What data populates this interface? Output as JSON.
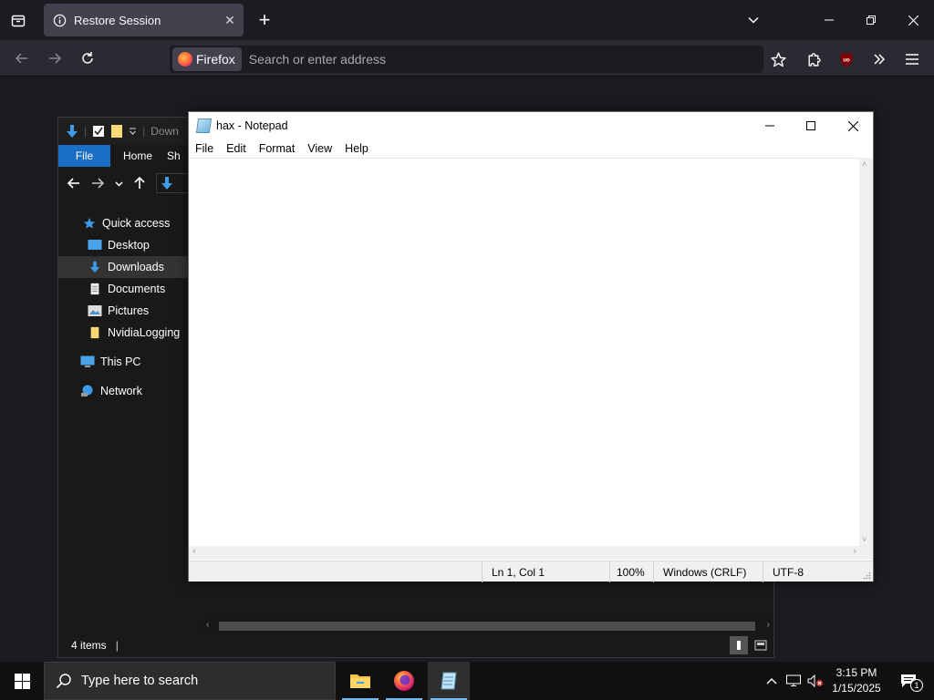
{
  "firefox": {
    "tab_title": "Restore Session",
    "identity_label": "Firefox",
    "address_placeholder": "Search or enter address"
  },
  "explorer": {
    "breadcrumb_fragment": "Down",
    "ribbon_tabs": [
      "File",
      "Home",
      "Sh"
    ],
    "sidebar": [
      {
        "label": "Quick access",
        "icon": "star-icon"
      },
      {
        "label": "Desktop",
        "icon": "desktop-folder-icon"
      },
      {
        "label": "Downloads",
        "icon": "download-arrow-icon",
        "selected": true
      },
      {
        "label": "Documents",
        "icon": "document-icon"
      },
      {
        "label": "Pictures",
        "icon": "picture-icon"
      },
      {
        "label": "NvidiaLogging",
        "icon": "folder-icon"
      },
      {
        "label": "This PC",
        "icon": "computer-icon"
      },
      {
        "label": "Network",
        "icon": "network-icon"
      }
    ],
    "status": "4 items"
  },
  "notepad": {
    "title": "hax - Notepad",
    "menu": [
      "File",
      "Edit",
      "Format",
      "View",
      "Help"
    ],
    "content": "",
    "status": {
      "position": "Ln 1, Col 1",
      "zoom": "100%",
      "line_ending": "Windows (CRLF)",
      "encoding": "UTF-8"
    }
  },
  "taskbar": {
    "search_placeholder": "Type here to search",
    "time": "3:15 PM",
    "date": "1/15/2025",
    "notification_count": "1"
  },
  "colors": {
    "firefox_tabbar": "#1c1b22",
    "firefox_navbar": "#2b2a33",
    "explorer_accent": "#1a6fc4",
    "taskbar_bg": "#101010",
    "taskbar_active_underline": "#76b9ed"
  }
}
